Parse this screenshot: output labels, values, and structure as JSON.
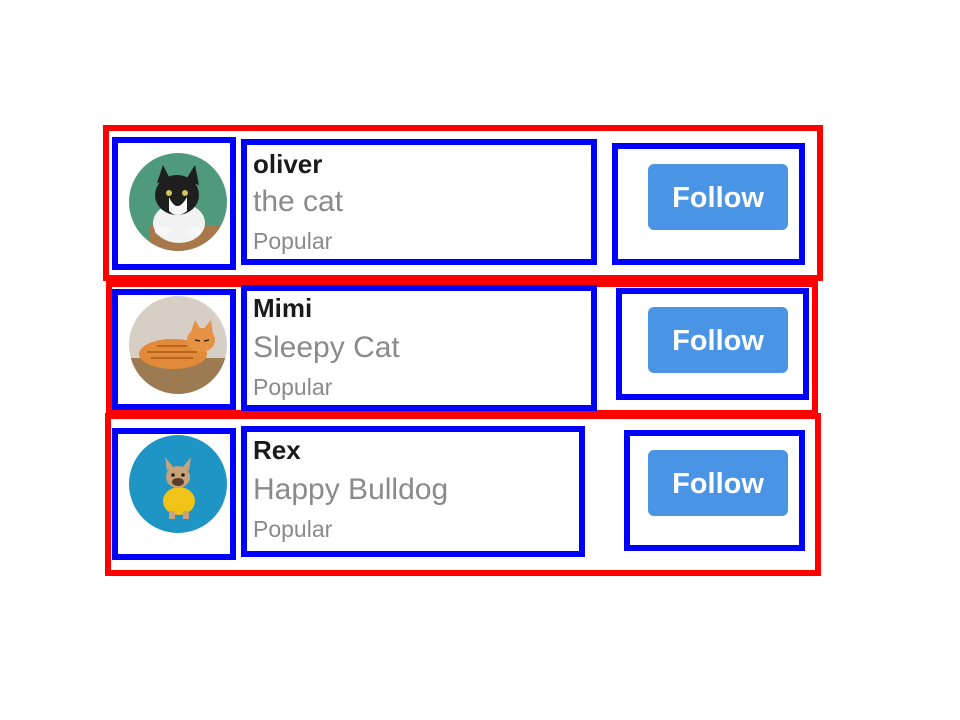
{
  "users": [
    {
      "name": "oliver",
      "subtitle": "the cat",
      "badge": "Popular",
      "follow_label": "Follow",
      "avatar": "tuxedo-cat-photo"
    },
    {
      "name": "Mimi",
      "subtitle": "Sleepy Cat",
      "badge": "Popular",
      "follow_label": "Follow",
      "avatar": "orange-tabby-cat-photo"
    },
    {
      "name": "Rex",
      "subtitle": "Happy Bulldog",
      "badge": "Popular",
      "follow_label": "Follow",
      "avatar": "french-bulldog-photo"
    }
  ],
  "colors": {
    "row_outline": "#ff0000",
    "cell_outline": "#0000ff",
    "button": "#4a94e6",
    "name_text": "#1a1a1a",
    "muted_text": "#8a8a8a"
  }
}
